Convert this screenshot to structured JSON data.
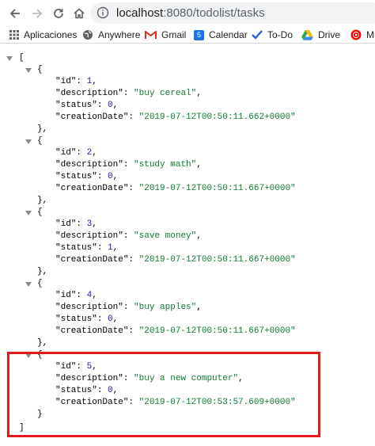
{
  "browser": {
    "url_host": "localhost",
    "url_path": ":8080/todolist/tasks"
  },
  "bookmarks": [
    {
      "label": "Aplicaciones",
      "icon": "apps-grid-icon"
    },
    {
      "label": "Anywhere",
      "icon": "globe-icon"
    },
    {
      "label": "Gmail",
      "icon": "gmail-icon"
    },
    {
      "label": "Calendar",
      "icon": "calendar-icon"
    },
    {
      "label": "To-Do",
      "icon": "check-icon"
    },
    {
      "label": "Drive",
      "icon": "drive-icon"
    },
    {
      "label": "Mu",
      "icon": "youtube-music-icon"
    }
  ],
  "calendar_day": "5",
  "json_viewer": {
    "open_bracket": "[",
    "close_bracket": "]",
    "open_brace": "{",
    "close_brace_comma": "},",
    "close_brace": "}",
    "keys": {
      "id": "\"id\"",
      "description": "\"description\"",
      "status": "\"status\"",
      "creationDate": "\"creationDate\""
    },
    "tasks": [
      {
        "id": "1",
        "description": "\"buy cereal\"",
        "status": "0",
        "creationDate": "\"2019-07-12T00:50:11.662+0000\""
      },
      {
        "id": "2",
        "description": "\"study math\"",
        "status": "0",
        "creationDate": "\"2019-07-12T00:50:11.667+0000\""
      },
      {
        "id": "3",
        "description": "\"save money\"",
        "status": "1",
        "creationDate": "\"2019-07-12T00:50:11.667+0000\""
      },
      {
        "id": "4",
        "description": "\"buy apples\"",
        "status": "0",
        "creationDate": "\"2019-07-12T00:50:11.667+0000\""
      },
      {
        "id": "5",
        "description": "\"buy a new computer\"",
        "status": "0",
        "creationDate": "\"2019-07-12T00:53:57.609+0000\""
      }
    ]
  },
  "colors": {
    "highlight_border": "#e01b1b",
    "json_number": "#1a1aa6",
    "json_string": "#0f7a32"
  }
}
